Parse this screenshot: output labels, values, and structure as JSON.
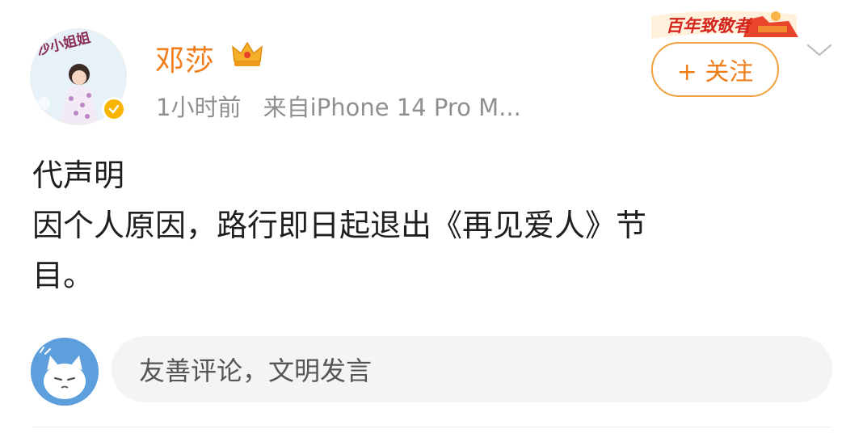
{
  "post": {
    "author": {
      "name": "邓莎",
      "avatar_caption": "沙小姐姐",
      "verified": true
    },
    "time": "1小时前",
    "source": "来自iPhone 14 Pro M...",
    "badge_text": "百年致敬者",
    "follow_label": "+ 关注",
    "content_lines": [
      "代声明",
      "因个人原因，路行即日起退出《再见爱人》节",
      "目。"
    ]
  },
  "comment": {
    "placeholder": "友善评论，文明发言"
  },
  "colors": {
    "accent": "#f07d19",
    "verified": "#f7b500",
    "meta_text": "#8f8f8f",
    "input_bg": "#f4f4f4"
  },
  "icons": [
    "crown-icon",
    "verified-icon",
    "chevron-down-icon"
  ]
}
